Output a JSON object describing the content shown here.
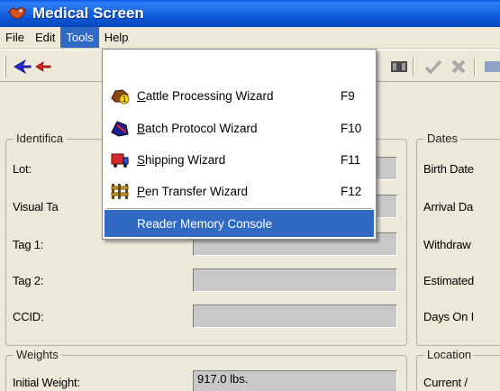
{
  "window": {
    "title": "Medical Screen"
  },
  "menubar": {
    "items": [
      {
        "label": "File"
      },
      {
        "label": "Edit"
      },
      {
        "label": "Tools"
      },
      {
        "label": "Help"
      }
    ]
  },
  "tools_menu": {
    "items": [
      {
        "label": "Cattle Processing Wizard",
        "accel": "C",
        "rest": "attle Processing Wizard",
        "shortcut": "F9",
        "icon": "cattle-processing-icon"
      },
      {
        "label": "Batch Protocol Wizard",
        "accel": "B",
        "rest": "atch Protocol Wizard",
        "shortcut": "F10",
        "icon": "batch-protocol-icon"
      },
      {
        "label": "Shipping Wizard",
        "accel": "S",
        "rest": "hipping Wizard",
        "shortcut": "F11",
        "icon": "shipping-truck-icon"
      },
      {
        "label": "Pen Transfer Wizard",
        "accel": "P",
        "rest": "en Transfer Wizard",
        "shortcut": "F12",
        "icon": "pen-transfer-icon"
      },
      {
        "label": "Reader Memory Console",
        "shortcut": "",
        "icon": ""
      }
    ]
  },
  "identification": {
    "legend": "Identifica",
    "lot_label": "Lot:",
    "visual_tag_label": "Visual Ta",
    "tag1_label": "Tag 1:",
    "tag2_label": "Tag 2:",
    "ccid_label": "CCID:"
  },
  "dates": {
    "legend": "Dates",
    "birth_label": "Birth Date",
    "arrival_label": "Arrival Da",
    "withdraw_label": "Withdraw",
    "estimated_label": "Estimated",
    "days_on_label": "Days On I"
  },
  "weights": {
    "legend": "Weights",
    "initial_label": "Initial Weight:",
    "initial_value": "917.0 lbs."
  },
  "location": {
    "legend": "Location",
    "current_label": "Current /"
  }
}
